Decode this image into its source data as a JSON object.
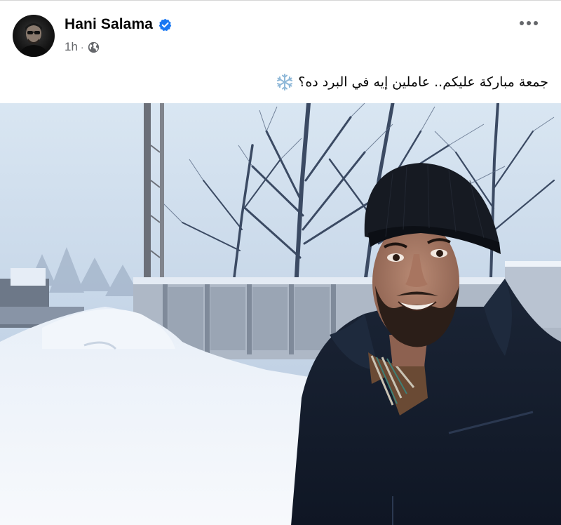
{
  "post": {
    "author": {
      "name": "Hani Salama",
      "verified": true,
      "avatar_icon": "profile-photo"
    },
    "meta": {
      "time": "1h",
      "separator": "·",
      "audience_icon": "globe-icon"
    },
    "menu_icon": "more-options-icon",
    "caption": "جمعة مباركة عليكم.. عاملين إيه في البرد ده؟",
    "caption_emoji": "snowflake-icon",
    "photo": {
      "description_icon": "selfie-snow-photo"
    }
  },
  "colors": {
    "verified_blue": "#1877f2",
    "meta_gray": "#65676b",
    "text": "#050505"
  }
}
